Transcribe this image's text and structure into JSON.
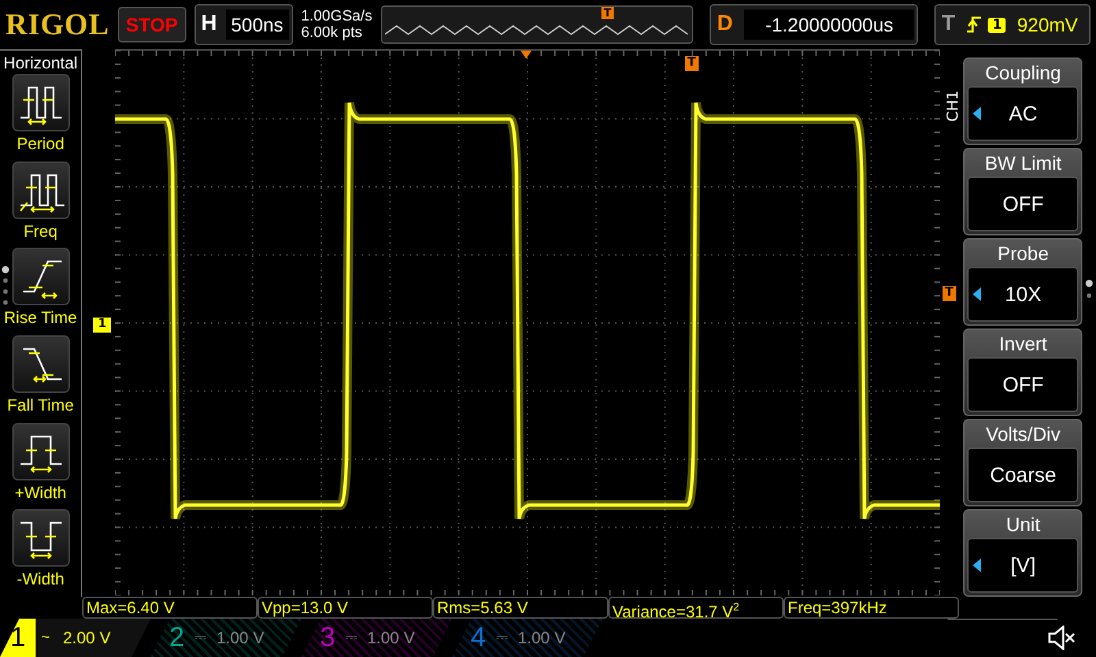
{
  "brand": "RIGOL",
  "run_state": "STOP",
  "timebase": {
    "label": "H",
    "value": "500ns"
  },
  "sample": {
    "rate": "1.00GSa/s",
    "depth": "6.00k pts"
  },
  "overview": {
    "trigger_label": "T"
  },
  "delay": {
    "label": "D",
    "value": "-1.20000000us"
  },
  "trigger": {
    "label": "T",
    "channel": "1",
    "level": "920mV"
  },
  "left_menu": {
    "title": "Horizontal",
    "items": [
      {
        "kind": "period",
        "label": "Period"
      },
      {
        "kind": "freq",
        "label": "Freq"
      },
      {
        "kind": "rise",
        "label": "Rise Time"
      },
      {
        "kind": "fall",
        "label": "Fall Time"
      },
      {
        "kind": "pwidth",
        "label": "+Width"
      },
      {
        "kind": "nwidth",
        "label": "-Width"
      }
    ]
  },
  "markers": {
    "channel_label": "1",
    "trigger_position_label": "T",
    "trigger_level_label": "T"
  },
  "right_menu": {
    "channel_label": "CH1",
    "items": [
      {
        "title": "Coupling",
        "value": "AC",
        "arrow": true
      },
      {
        "title": "BW Limit",
        "value": "OFF",
        "arrow": false
      },
      {
        "title": "Probe",
        "value": "10X",
        "arrow": true
      },
      {
        "title": "Invert",
        "value": "OFF",
        "arrow": false
      },
      {
        "title": "Volts/Div",
        "value": "Coarse",
        "arrow": false
      },
      {
        "title": "Unit",
        "value": "[V]",
        "arrow": true
      }
    ]
  },
  "measurements": [
    {
      "text": "Max=6.40 V"
    },
    {
      "text": "Vpp=13.0 V"
    },
    {
      "text": "Rms=5.63 V"
    },
    {
      "text": "Variance=31.7 V$^{2}$"
    },
    {
      "text": "Freq=397kHz"
    }
  ],
  "channels": [
    {
      "number": "1",
      "coupling": "~",
      "scale": "2.00 V",
      "on": true,
      "color": "#ffff00"
    },
    {
      "number": "2",
      "coupling": "⎓",
      "scale": "1.00 V",
      "on": false,
      "color": "#00a890"
    },
    {
      "number": "3",
      "coupling": "⎓",
      "scale": "1.00 V",
      "on": false,
      "color": "#c000c0"
    },
    {
      "number": "4",
      "coupling": "⎓",
      "scale": "1.00 V",
      "on": false,
      "color": "#1070d0"
    }
  ]
}
